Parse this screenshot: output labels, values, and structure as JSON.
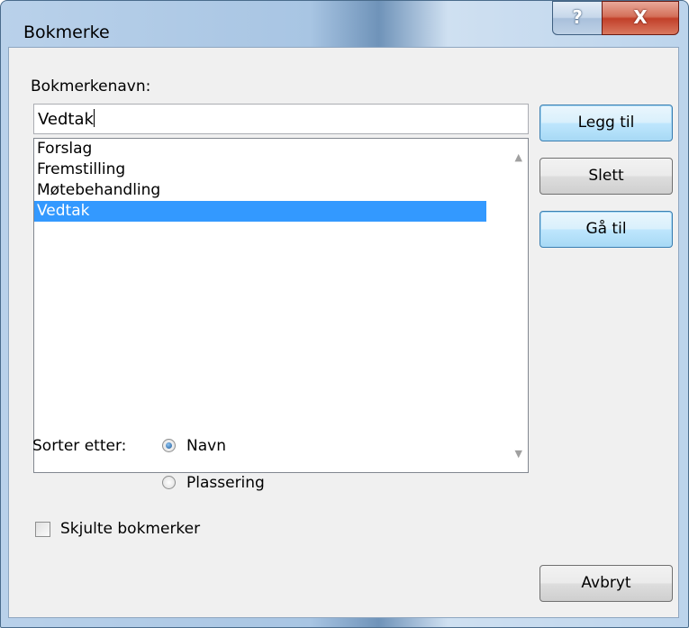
{
  "window": {
    "title": "Bokmerke",
    "help_glyph": "?",
    "close_glyph": "X"
  },
  "name_label": "Bokmerkenavn:",
  "name_input_value": "Vedtak",
  "bookmarks": [
    "Forslag",
    "Fremstilling",
    "Møtebehandling",
    "Vedtak"
  ],
  "selected_bookmark": "Vedtak",
  "buttons": {
    "add": "Legg til",
    "delete": "Slett",
    "goto": "Gå til",
    "cancel": "Avbryt"
  },
  "sort": {
    "label": "Sorter etter:",
    "options": [
      "Navn",
      "Plassering"
    ],
    "selected": "Navn"
  },
  "hidden_bookmarks": {
    "label": "Skjulte bokmerker",
    "checked": false
  },
  "colors": {
    "selection": "#3399ff",
    "dialog_background": "#f0f0f0"
  }
}
